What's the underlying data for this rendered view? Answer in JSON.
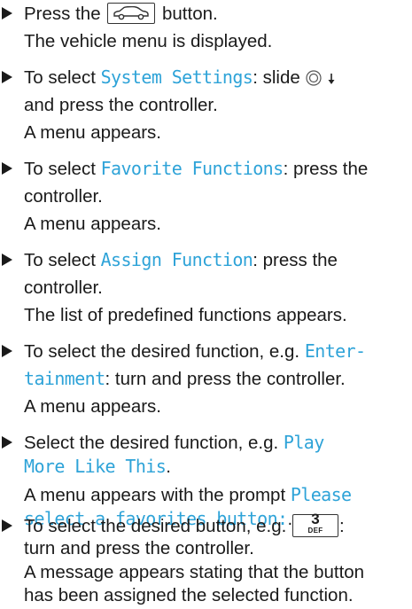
{
  "steps": [
    {
      "lines": [
        [
          "Press the ",
          "button."
        ],
        [
          "The vehicle menu is displayed."
        ]
      ]
    },
    {
      "lines": [
        [
          "To select ",
          "System Settings",
          ": slide"
        ],
        [
          "and press the controller."
        ],
        [
          "A menu appears."
        ]
      ]
    },
    {
      "lines": [
        [
          "To select ",
          "Favorite Functions",
          ": press the"
        ],
        [
          "controller."
        ],
        [
          "A menu appears."
        ]
      ]
    },
    {
      "lines": [
        [
          "To select ",
          "Assign Function",
          ": press the"
        ],
        [
          "controller."
        ],
        [
          "The list of predefined functions appears."
        ]
      ]
    },
    {
      "lines": [
        [
          "To select the desired function, e.g. ",
          "Enter-"
        ],
        [
          "tainment",
          ": turn and press the controller."
        ],
        [
          "A menu appears."
        ]
      ]
    },
    {
      "lines": [
        [
          "Select the desired function, e.g. ",
          "Play"
        ],
        [
          "More Like This",
          "."
        ],
        [
          "A menu appears with the prompt ",
          "Please"
        ],
        [
          "select a favorites button:",
          "."
        ]
      ]
    },
    {
      "lines": [
        [
          "To select the desired button, e.g. ",
          ":"
        ],
        [
          "turn and press the controller."
        ],
        [
          "A message appears stating that the button"
        ],
        [
          "has been assigned the selected function."
        ]
      ]
    }
  ],
  "key_button": {
    "number": "3",
    "letters": "DEF"
  },
  "icons": [
    "vehicle-button-icon",
    "controller-icon",
    "arrow-down-icon",
    "bullet-triangle-icon"
  ]
}
